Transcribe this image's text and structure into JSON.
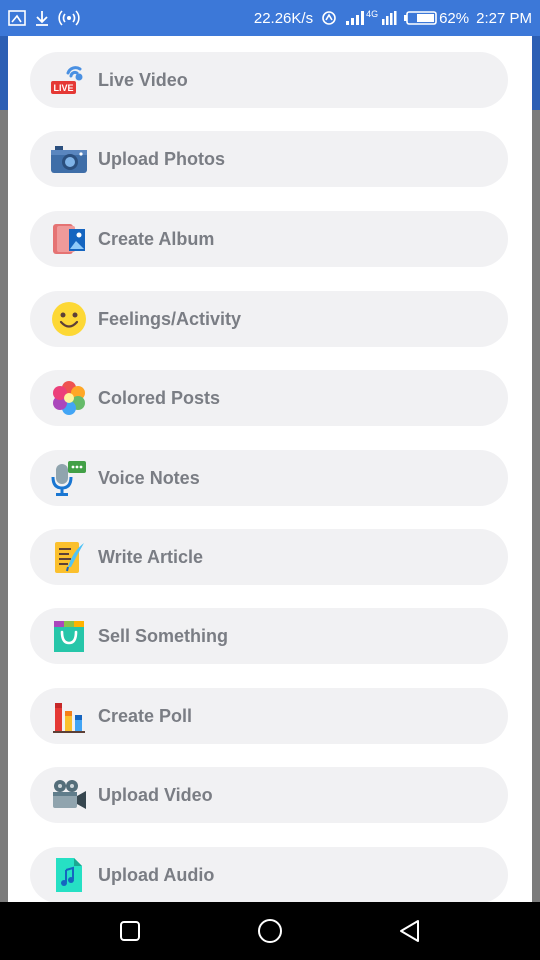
{
  "status_bar": {
    "net_speed": "22.26K/s",
    "network_type": "4G",
    "battery": "62%",
    "time": "2:27 PM"
  },
  "menu": {
    "items": [
      {
        "label": "Live Video",
        "icon": "live-video-icon"
      },
      {
        "label": "Upload Photos",
        "icon": "camera-icon"
      },
      {
        "label": "Create Album",
        "icon": "album-icon"
      },
      {
        "label": "Feelings/Activity",
        "icon": "smiley-icon"
      },
      {
        "label": "Colored Posts",
        "icon": "flower-icon"
      },
      {
        "label": "Voice Notes",
        "icon": "microphone-icon"
      },
      {
        "label": "Write Article",
        "icon": "quill-article-icon"
      },
      {
        "label": "Sell Something",
        "icon": "shopping-bag-icon"
      },
      {
        "label": "Create Poll",
        "icon": "poll-bars-icon"
      },
      {
        "label": "Upload Video",
        "icon": "video-camera-icon"
      },
      {
        "label": "Upload Audio",
        "icon": "audio-file-icon"
      }
    ]
  },
  "nav_bar": {
    "buttons": [
      "recent-apps-icon",
      "home-icon",
      "back-icon"
    ]
  }
}
